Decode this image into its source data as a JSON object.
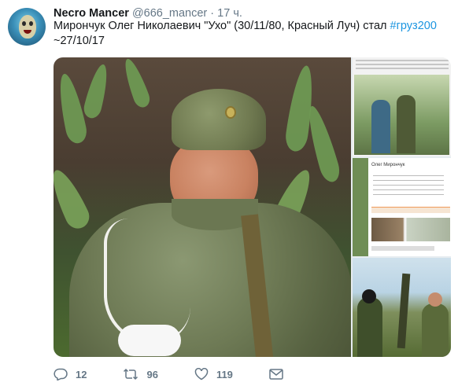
{
  "tweet": {
    "author_name": "Necro Mancer",
    "author_handle": "@666_mancer",
    "separator": "·",
    "time": "17 ч.",
    "text_line1": "Мирончук Олег Николаевич \"Ухо\" (30/11/80, Красный Луч) стал ",
    "hashtag": "#груз200",
    "text_line2": "~27/10/17"
  },
  "sidebar_media": {
    "profile_name": "Олег Мирончук"
  },
  "actions": {
    "reply_count": "12",
    "retweet_count": "96",
    "like_count": "119"
  },
  "icons": {
    "reply": "reply-icon",
    "retweet": "retweet-icon",
    "like": "heart-icon",
    "message": "message-icon"
  },
  "colors": {
    "link": "#1b95e0",
    "muted": "#657786",
    "text": "#14171a"
  }
}
